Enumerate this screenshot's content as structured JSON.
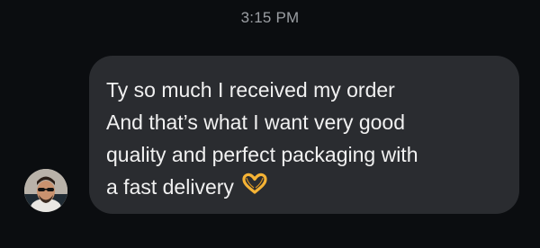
{
  "conversation": {
    "timestamp": "3:15 PM",
    "message": {
      "sender_avatar": "person-with-sunglasses-avatar",
      "lines": [
        "Ty so much I received my order",
        "And that’s what I want very good",
        "quality and perfect packaging with",
        "a fast delivery"
      ],
      "emoji": "heart-hands-emoji"
    }
  },
  "colors": {
    "background": "#0b0d10",
    "bubble": "#2a2c30",
    "timestamp_text": "#9b9ea3",
    "message_text": "#f1f1f1",
    "emoji": "#f5b335"
  }
}
